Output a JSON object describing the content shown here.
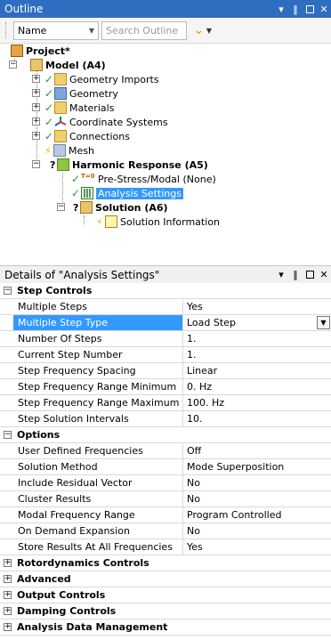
{
  "outline": {
    "title": "Outline",
    "pin_glyph": "‖",
    "close_glyph": "✕",
    "dropdown_glyph": "▾",
    "name_combo_value": "Name",
    "search_placeholder": "Search Outline"
  },
  "tree": {
    "project": "Project*",
    "model": "Model (A4)",
    "items": {
      "geometry_imports": "Geometry Imports",
      "geometry": "Geometry",
      "materials": "Materials",
      "coordinate_systems": "Coordinate Systems",
      "connections": "Connections",
      "mesh": "Mesh"
    },
    "harmonic": "Harmonic Response (A5)",
    "prestress": "Pre-Stress/Modal (None)",
    "prestress_badge": "T=0",
    "analysis_settings": "Analysis Settings",
    "solution": "Solution (A6)",
    "solution_info": "Solution Information"
  },
  "details": {
    "title": "Details of \"Analysis Settings\"",
    "sections": {
      "step_controls": "Step Controls",
      "options": "Options",
      "rotordynamics": "Rotordynamics Controls",
      "advanced": "Advanced",
      "output": "Output Controls",
      "damping": "Damping Controls",
      "data_mgmt": "Analysis Data Management"
    },
    "step_rows": [
      {
        "label": "Multiple Steps",
        "value": "Yes"
      },
      {
        "label": "Multiple Step Type",
        "value": "Load Step"
      },
      {
        "label": "Number Of Steps",
        "value": "1."
      },
      {
        "label": "Current Step Number",
        "value": "1."
      },
      {
        "label": "Step Frequency Spacing",
        "value": "Linear"
      },
      {
        "label": "Step Frequency Range Minimum",
        "value": "0. Hz"
      },
      {
        "label": "Step Frequency Range Maximum",
        "value": "100. Hz"
      },
      {
        "label": "Step Solution Intervals",
        "value": "10."
      }
    ],
    "option_rows": [
      {
        "label": "User Defined Frequencies",
        "value": "Off"
      },
      {
        "label": "Solution Method",
        "value": "Mode Superposition"
      },
      {
        "label": "Include Residual Vector",
        "value": "No"
      },
      {
        "label": "Cluster Results",
        "value": "No"
      },
      {
        "label": "Modal Frequency Range",
        "value": "Program Controlled"
      },
      {
        "label": "On Demand Expansion",
        "value": "No"
      },
      {
        "label": "Store Results At All Frequencies",
        "value": "Yes"
      }
    ]
  }
}
